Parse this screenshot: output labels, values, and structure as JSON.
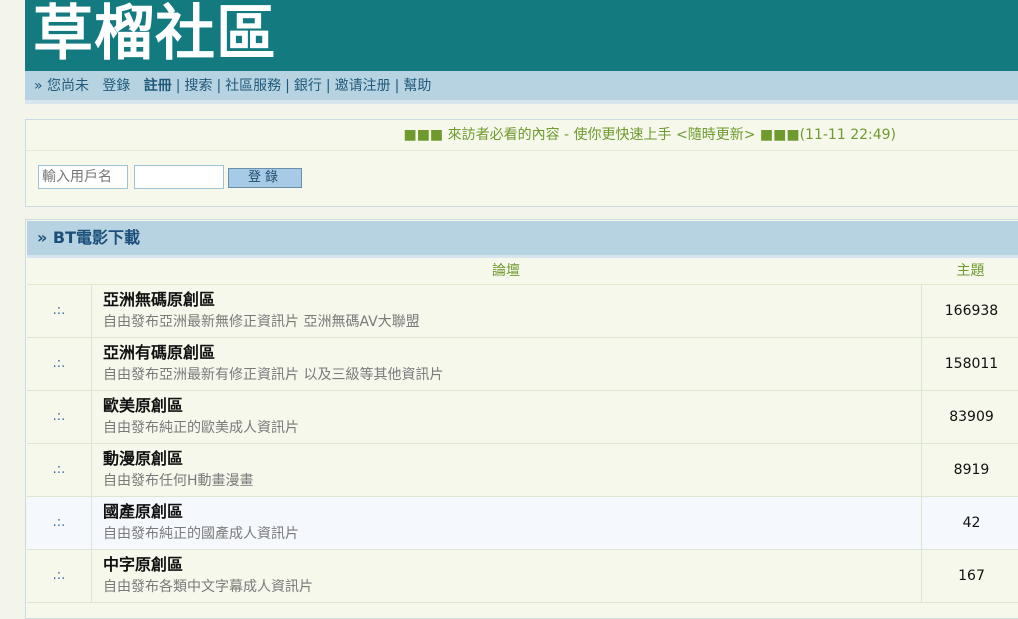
{
  "header": {
    "logo": "草榴社區"
  },
  "navbar": {
    "prefix": "» 您尚未",
    "login": "登錄",
    "register": "註冊",
    "items": [
      "搜索",
      "社區服務",
      "銀行",
      "邀请注册",
      "幫助"
    ]
  },
  "notice": {
    "text": "■■■ 來訪者必看的內容 - 使你更快速上手 <隨時更新> ■■■(11-11 22:49)"
  },
  "login_form": {
    "username_placeholder": "輸入用戶名",
    "password_value": "",
    "button_label": "登錄"
  },
  "forum": {
    "title": "» BT電影下載",
    "columns": {
      "forum": "論壇",
      "topics": "主題"
    },
    "rows": [
      {
        "icon": ".:.",
        "name": "亞洲無碼原創區",
        "desc": "自由發布亞洲最新無修正資訊片 亞洲無碼AV大聯盟",
        "topics": "166938"
      },
      {
        "icon": ".:.",
        "name": "亞洲有碼原創區",
        "desc": "自由發布亞洲最新有修正資訊片 以及三級等其他資訊片",
        "topics": "158011"
      },
      {
        "icon": ".:.",
        "name": "歐美原創區",
        "desc": "自由發布純正的歐美成人資訊片",
        "topics": "83909"
      },
      {
        "icon": ".:.",
        "name": "動漫原創區",
        "desc": "自由發布任何H動畫漫畫",
        "topics": "8919"
      },
      {
        "icon": ".:.",
        "name": "國產原創區",
        "desc": "自由發布純正的國產成人資訊片",
        "topics": "42"
      },
      {
        "icon": ".:.",
        "name": "中字原創區",
        "desc": "自由發布各類中文字幕成人資訊片",
        "topics": "167"
      }
    ]
  }
}
